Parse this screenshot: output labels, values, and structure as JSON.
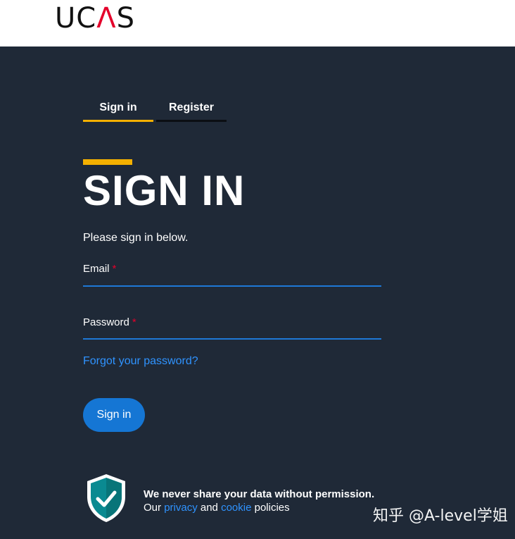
{
  "header": {
    "logo_text": "UCAS"
  },
  "tabs": [
    {
      "label": "Sign in",
      "active": true
    },
    {
      "label": "Register",
      "active": false
    }
  ],
  "page": {
    "title": "SIGN IN",
    "intro": "Please sign in below."
  },
  "form": {
    "email_label": "Email",
    "password_label": "Password",
    "required_marker": "*",
    "forgot_link": "Forgot your password?",
    "submit_label": "Sign in"
  },
  "privacy_notice": {
    "headline": "We never share your data without permission.",
    "our": "Our",
    "privacy_link": "privacy",
    "and": "and",
    "cookie_link": "cookie",
    "policies": "policies"
  },
  "watermark": "知乎 @A-level学姐",
  "colors": {
    "background": "#1f2937",
    "accent_yellow": "#f4b000",
    "link_blue": "#2f93ff",
    "button_blue": "#1576d4",
    "required_red": "#e4002b"
  },
  "icons": {
    "shield": "shield-check-icon"
  }
}
